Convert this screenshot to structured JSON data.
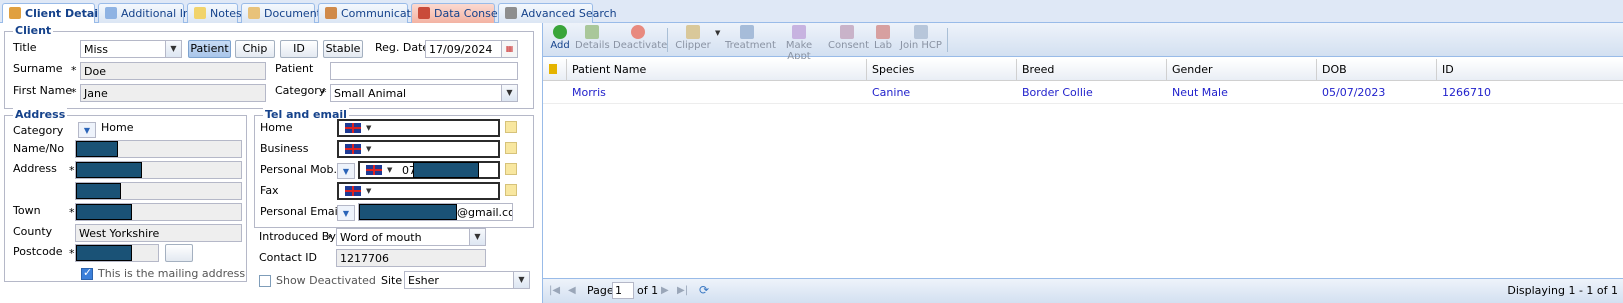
{
  "tabs": [
    {
      "label": "Client Details"
    },
    {
      "label": "Additional Info"
    },
    {
      "label": "Notes"
    },
    {
      "label": "Documents"
    },
    {
      "label": "Communication"
    },
    {
      "label": "Data Consent"
    },
    {
      "label": "Advanced Search"
    }
  ],
  "client": {
    "legend": "Client",
    "title_label": "Title",
    "title_value": "Miss",
    "buttons": {
      "patient": "Patient",
      "chip": "Chip",
      "id": "ID",
      "stable": "Stable"
    },
    "reg_date_label": "Reg. Date",
    "reg_date_value": "17/09/2024",
    "surname_label": "Surname",
    "surname_value": "Doe",
    "patient_label": "Patient",
    "patient_value": "",
    "first_name_label": "First Name",
    "first_name_value": "Jane",
    "category_label": "Category",
    "category_value": "Small Animal"
  },
  "address": {
    "legend": "Address",
    "category_label": "Category",
    "category_value": "Home",
    "name_no_label": "Name/No",
    "address_label": "Address",
    "town_label": "Town",
    "county_label": "County",
    "county_value": "West Yorkshire",
    "postcode_label": "Postcode",
    "mailing_label": "This is the mailing address"
  },
  "tel": {
    "legend": "Tel and email",
    "home_label": "Home",
    "business_label": "Business",
    "mobile_label": "Personal Mob.",
    "mobile_prefix": "07",
    "fax_label": "Fax",
    "email_label": "Personal Email",
    "email_suffix": "@gmail.com"
  },
  "misc": {
    "introduced_by_label": "Introduced By",
    "introduced_by_value": "Word of mouth",
    "contact_id_label": "Contact ID",
    "contact_id_value": "1217706",
    "show_deactivated_label": "Show Deactivated",
    "site_label": "Site",
    "site_value": "Esher"
  },
  "toolbar": {
    "add": "Add",
    "details": "Details",
    "deactivate": "Deactivate",
    "clipper": "Clipper",
    "treatment": "Treatment",
    "make_appt": "Make Appt",
    "consent": "Consent",
    "lab": "Lab",
    "join_hcp": "Join HCP"
  },
  "grid": {
    "headers": [
      "Patient Name",
      "Species",
      "Breed",
      "Gender",
      "DOB",
      "ID"
    ],
    "rows": [
      [
        "Morris",
        "Canine",
        "Border Collie",
        "Neut Male",
        "05/07/2023",
        "1266710"
      ]
    ]
  },
  "pager": {
    "page_label": "Page",
    "page_value": "1",
    "of_label": "of 1",
    "displaying": "Displaying 1 - 1 of 1"
  },
  "colors": {
    "accent": "#15428b",
    "link": "#2222cc",
    "redaction": "#1a5276",
    "consent_tab": "#f3b3a3"
  }
}
